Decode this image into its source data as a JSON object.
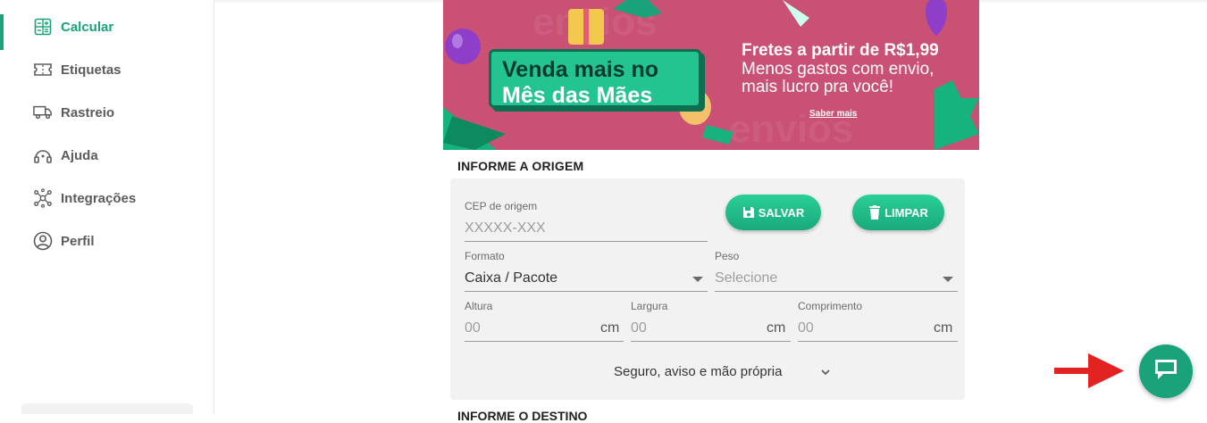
{
  "sidebar": {
    "items": [
      {
        "label": "Calcular",
        "icon": "calculator-icon",
        "active": true
      },
      {
        "label": "Etiquetas",
        "icon": "ticket-icon",
        "active": false
      },
      {
        "label": "Rastreio",
        "icon": "truck-icon",
        "active": false
      },
      {
        "label": "Ajuda",
        "icon": "headset-icon",
        "active": false
      },
      {
        "label": "Integrações",
        "icon": "network-icon",
        "active": false
      },
      {
        "label": "Perfil",
        "icon": "user-circle-icon",
        "active": false
      }
    ]
  },
  "banner": {
    "promo_line1": "Venda mais no",
    "promo_line2": "Mês das Mães",
    "headline": "Fretes a partir de R$1,99",
    "subline1": "Menos gastos com envio,",
    "subline2": "mais lucro pra você!",
    "link": "Saber mais"
  },
  "origin": {
    "title": "INFORME A ORIGEM",
    "cep_label": "CEP de origem",
    "cep_placeholder": "XXXXX-XXX",
    "save_label": "SALVAR",
    "clear_label": "LIMPAR",
    "format_label": "Formato",
    "format_value": "Caixa / Pacote",
    "weight_label": "Peso",
    "weight_value": "Selecione",
    "height_label": "Altura",
    "height_placeholder": "00",
    "width_label": "Largura",
    "width_placeholder": "00",
    "length_label": "Comprimento",
    "length_placeholder": "00",
    "unit": "cm",
    "extras_label": "Seguro, aviso e mão própria"
  },
  "destination": {
    "title": "INFORME O DESTINO"
  },
  "colors": {
    "accent": "#1aa37a",
    "banner_bg": "#c95174",
    "arrow": "#e32222"
  }
}
